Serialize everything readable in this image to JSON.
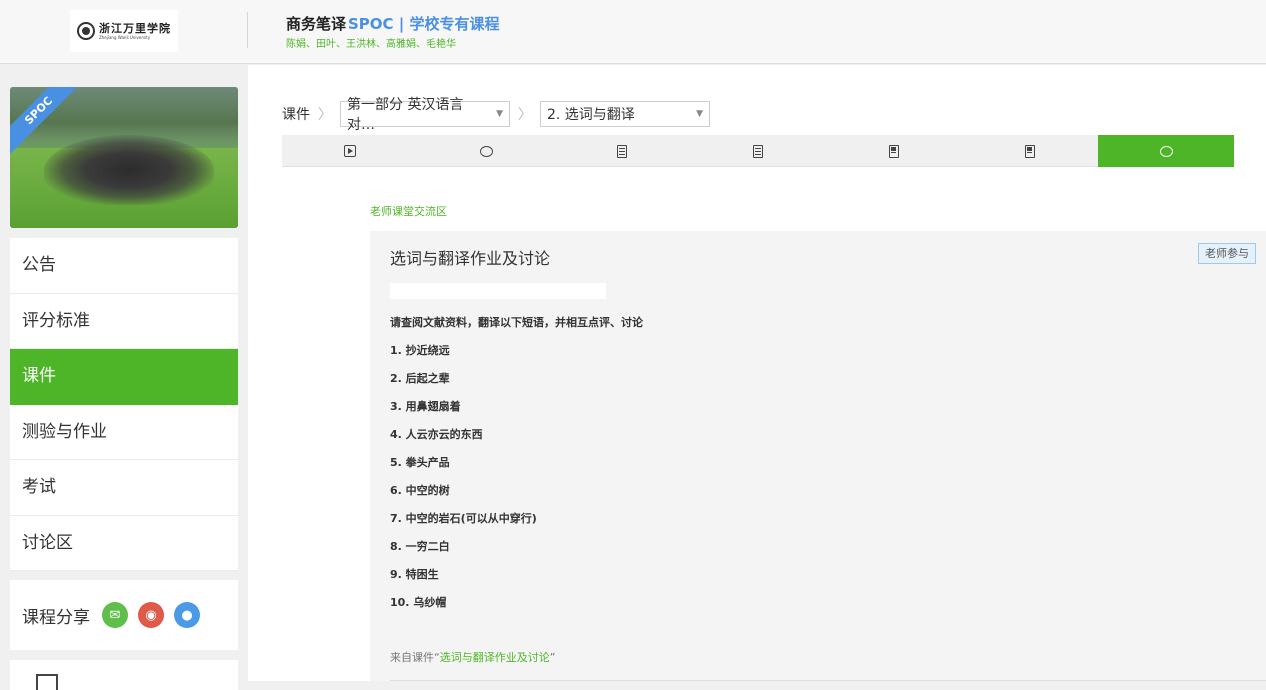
{
  "header": {
    "logo_cn": "浙江万里学院",
    "logo_en": "Zhejiang Wanli University",
    "course_title": "商务笔译",
    "course_tag": "SPOC | 学校专有课程",
    "teachers": "陈娟、田叶、王洪林、高雅娟、毛艳华"
  },
  "sidebar": {
    "cover_ribbon": "SPOC",
    "items": [
      {
        "label": "公告",
        "active": false
      },
      {
        "label": "评分标准",
        "active": false
      },
      {
        "label": "课件",
        "active": true
      },
      {
        "label": "测验与作业",
        "active": false
      },
      {
        "label": "考试",
        "active": false
      },
      {
        "label": "讨论区",
        "active": false
      }
    ],
    "share_label": "课程分享",
    "share_icons": [
      "wechat-icon",
      "weibo-icon",
      "qq-icon"
    ]
  },
  "breadcrumb": {
    "root": "课件",
    "chapter": "第一部分 英汉语言对…",
    "lesson": "2. 选词与翻译"
  },
  "tabs": [
    {
      "icon": "video-icon",
      "active": false
    },
    {
      "icon": "discussion-icon",
      "active": false
    },
    {
      "icon": "document-icon",
      "active": false
    },
    {
      "icon": "document-icon",
      "active": false
    },
    {
      "icon": "quiz-icon",
      "active": false
    },
    {
      "icon": "quiz-icon",
      "active": false
    },
    {
      "icon": "discussion-icon",
      "active": true
    }
  ],
  "main": {
    "section_label": "老师课堂交流区",
    "post": {
      "title": "选词与翻译作业及讨论",
      "badge": "老师参与",
      "instruction": "请查阅文献资料，翻译以下短语，并相互点评、讨论",
      "items": [
        "1. 抄近绕远",
        "2. 后起之辈",
        "3. 用鼻翅扇着",
        "4. 人云亦云的东西",
        "5. 拳头产品",
        "6. 中空的树",
        "7. 中空的岩石(可以从中穿行)",
        "8. 一穷二白",
        "9. 特困生",
        "10. 乌纱帽"
      ],
      "from_prefix": "来自课件“",
      "from_link": "选词与翻译作业及讨论",
      "from_suffix": "”"
    }
  },
  "colors": {
    "accent_green": "#4fb528",
    "accent_blue": "#4a90e2"
  }
}
